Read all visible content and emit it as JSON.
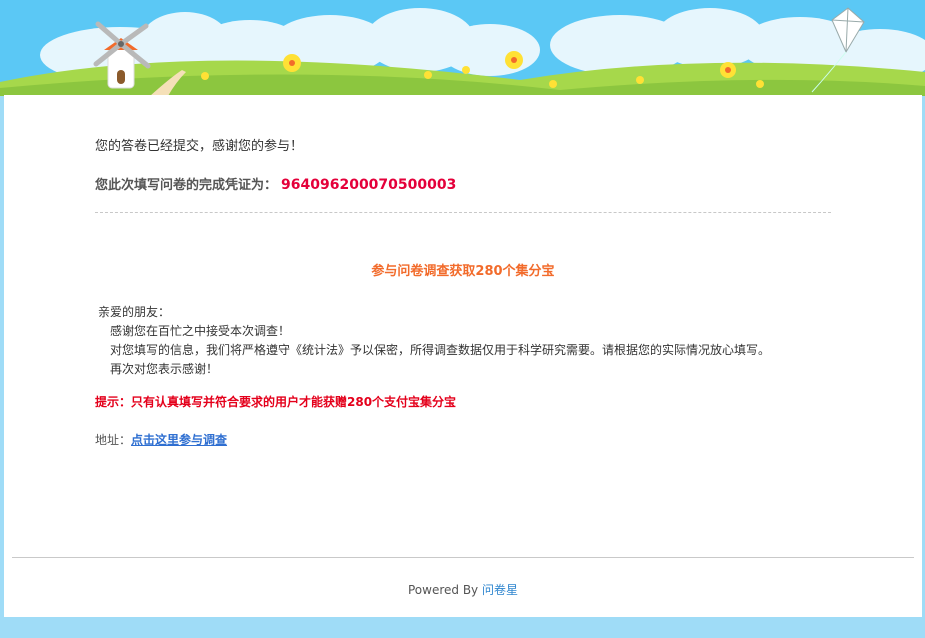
{
  "message": {
    "thanks": "您的答卷已经提交，感谢您的参与！",
    "certificate_label": "您此次填写问卷的完成凭证为：",
    "certificate_number": "964096200070500003"
  },
  "promo": {
    "title": "参与问卷调查获取280个集分宝",
    "greeting": "亲爱的朋友：",
    "lines": [
      "感谢您在百忙之中接受本次调查！",
      "对您填写的信息，我们将严格遵守《统计法》予以保密，所得调查数据仅用于科学研究需要。请根据您的实际情况放心填写。",
      "再次对您表示感谢！"
    ],
    "tip": "提示：只有认真填写并符合要求的用户才能获赠280个支付宝集分宝",
    "address_label": "地址：",
    "address_link": "点击这里参与调查"
  },
  "footer": {
    "powered_by": "Powered By",
    "brand": "问卷星"
  },
  "colors": {
    "sky": "#5bc8f5",
    "grass": "#8cc63f",
    "accent_red": "#e4003a",
    "accent_orange": "#f26b2b",
    "link": "#2f6fd1"
  }
}
